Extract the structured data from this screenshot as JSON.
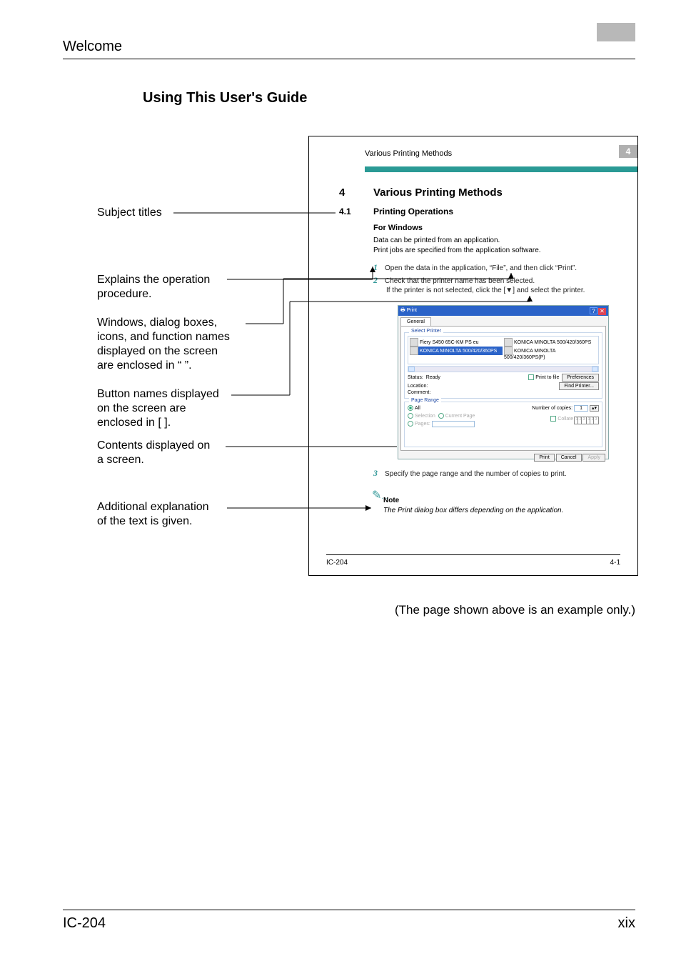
{
  "header": {
    "running": "Welcome"
  },
  "section": {
    "title": "Using This User's Guide"
  },
  "labels": {
    "subject": "Subject titles",
    "explains1": "Explains the operation",
    "explains2": "procedure.",
    "windows1": "Windows, dialog boxes,",
    "windows2": "icons, and function names",
    "windows3": "displayed on the screen",
    "windows4": "are enclosed in “ ”.",
    "buttons1": "Button names displayed",
    "buttons2": "on the screen are",
    "buttons3": "enclosed in [  ].",
    "contents1": "Contents displayed on",
    "contents2": "a screen.",
    "addl1": "Additional explanation",
    "addl2": "of the text is given."
  },
  "sample": {
    "hdr_small": "Various Printing Methods",
    "hdr_chip": "4",
    "chap_num": "4",
    "chap_title": "Various Printing Methods",
    "sec_num": "4.1",
    "sec_title": "Printing Operations",
    "subhead": "For Windows",
    "body1": "Data can be printed from an application.",
    "body2": "Print jobs are specified from the application software.",
    "step1": "Open the data in the application, “File”, and then click “Print”.",
    "step2": "Check that the printer name has been selected.",
    "step2b": "If the printer is not selected, click the [▼] and select the printer.",
    "step3": "Specify the page range and the number of copies to print.",
    "note_label": "Note",
    "note_text": "The Print dialog box differs depending on the application.",
    "dlg": {
      "title": "Print",
      "tab": "General",
      "gb_select": "Select Printer",
      "printers": {
        "p1": "Fiery S450 65C-KM PS eu",
        "p2": "KONICA MINOLTA 500/420/360PS",
        "p3": "KONICA MINOLTA 500/420/360PS",
        "p4": "KONICA MINOLTA 500/420/360PS(P)"
      },
      "status_l": "Status:",
      "status_v": "Ready",
      "location_l": "Location:",
      "comment_l": "Comment:",
      "print_to_file": "Print to file",
      "preferences": "Preferences",
      "find_printer": "Find Printer...",
      "gb_range": "Page Range",
      "all": "All",
      "selection": "Selection",
      "current_page": "Current Page",
      "pages": "Pages:",
      "copies_l": "Number of copies:",
      "copies_v": "1",
      "collate": "Collate",
      "btn_print": "Print",
      "btn_cancel": "Cancel",
      "btn_apply": "Apply"
    },
    "foot_l": "IC-204",
    "foot_r": "4-1"
  },
  "caption": "(The page shown above is an example only.)",
  "footer": {
    "left": "IC-204",
    "right": "xix"
  }
}
